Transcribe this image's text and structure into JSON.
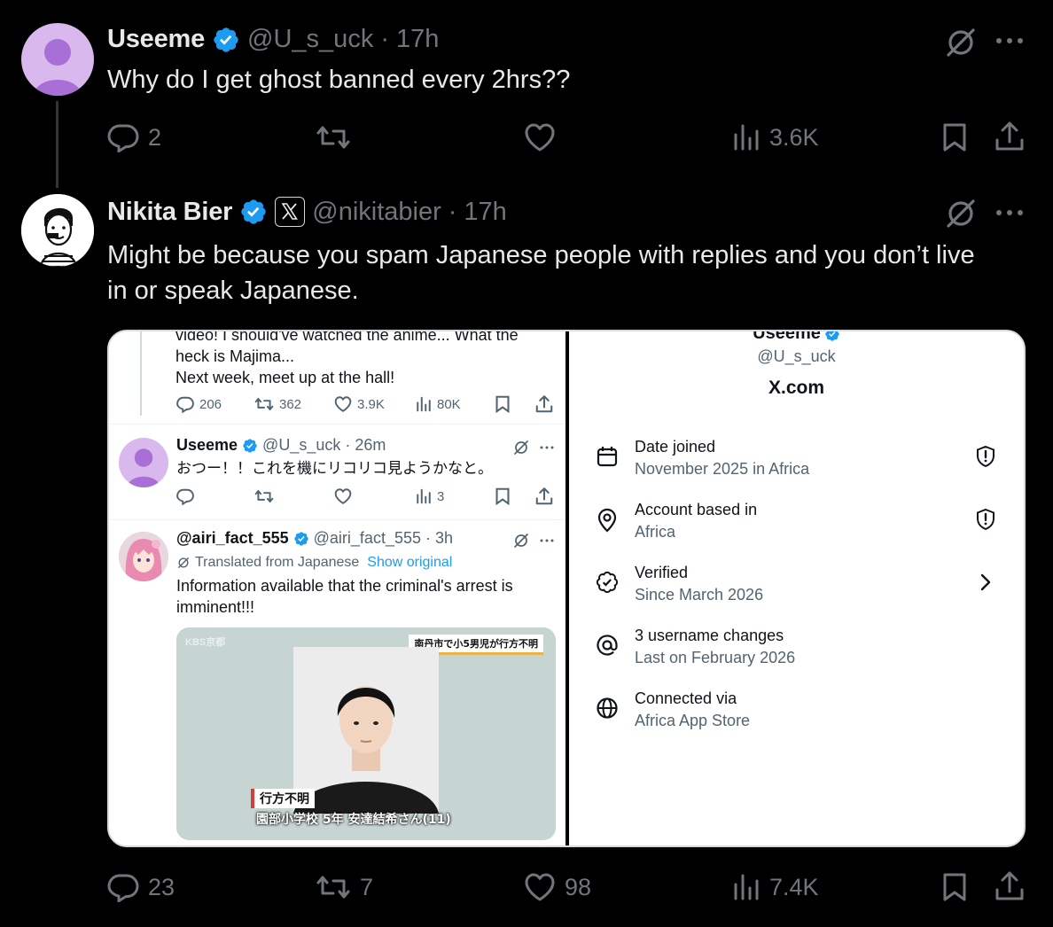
{
  "tweet1": {
    "name": "Useeme",
    "handle": "@U_s_uck",
    "time": "17h",
    "separator": "·",
    "text": "Why do I get ghost banned every 2hrs??",
    "replies": "2",
    "reposts": "",
    "likes": "",
    "views": "3.6K"
  },
  "tweet2": {
    "name": "Nikita Bier",
    "handle": "@nikitabier",
    "time": "17h",
    "separator": "·",
    "text_line1": "Might be because you spam Japanese people with replies and you don’t live",
    "text_line2": "in or speak Japanese.",
    "replies": "23",
    "reposts": "7",
    "likes": "98",
    "views": "7.4K"
  },
  "screenshot_left": {
    "top_cut_text": "video! I should've watched the anime... What the",
    "line2": "heck is Majima...",
    "line3": "Next week, meet up at the hall!",
    "stats": {
      "replies": "206",
      "reposts": "362",
      "likes": "3.9K",
      "views": "80K"
    },
    "reply1": {
      "name": "Useeme",
      "handle": "@U_s_uck",
      "time": "26m",
      "text": "おつー！！これを機にリコリコ見ようかなと。",
      "views": "3"
    },
    "reply2": {
      "name": "@airi_fact_555",
      "handle": "@airi_fact_555",
      "time": "3h",
      "translated": "Translated from Japanese",
      "show_original": "Show original",
      "text_line1": "Information available that the criminal's arrest is",
      "text_line2": "imminent!!!",
      "news_tag": "南丹市で小5男児が行方不明",
      "news_logo": "KBS京都",
      "caption_label": "行方不明",
      "caption_text": "園部小学校 5年 安達結希さん(11)"
    }
  },
  "screenshot_right": {
    "name": "Useeme",
    "handle": "@U_s_uck",
    "site": "X.com",
    "rows": [
      {
        "label": "Date joined",
        "sub": "November 2025 in Africa",
        "icon": "calendar-icon",
        "trail": "shield-alert-icon"
      },
      {
        "label": "Account based in",
        "sub": "Africa",
        "icon": "location-pin-icon",
        "trail": "shield-alert-icon"
      },
      {
        "label": "Verified",
        "sub": "Since March 2026",
        "icon": "verified-badge-icon",
        "trail": "chevron-right-icon"
      },
      {
        "label": "3 username changes",
        "sub": "Last on February 2026",
        "icon": "at-sign-icon",
        "trail": ""
      },
      {
        "label": "Connected via",
        "sub": "Africa App Store",
        "icon": "globe-icon",
        "trail": ""
      }
    ]
  },
  "colors": {
    "background": "#000000",
    "text": "#e7e9ea",
    "muted": "#71767b",
    "verified": "#1d9bf0",
    "link": "#1d9bf0"
  }
}
